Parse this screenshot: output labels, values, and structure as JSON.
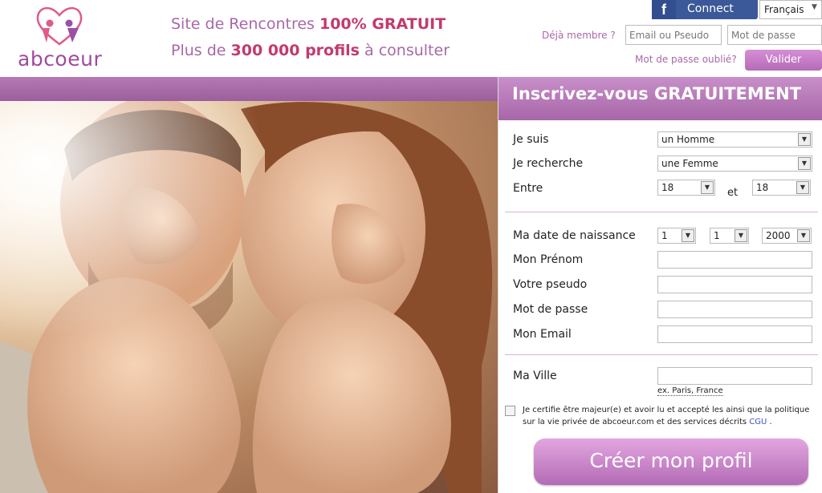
{
  "header": {
    "logo_text": "abcoeur",
    "tagline1_prefix": "Site de Rencontres ",
    "tagline1_bold": "100% GRATUIT",
    "tagline2_prefix": "Plus de ",
    "tagline2_bold": "300 000 profils",
    "tagline2_suffix": " à consulter",
    "facebook_label": "Connect",
    "language": "Français",
    "member_prompt": "Déjà membre ?",
    "email_placeholder": "Email ou Pseudo",
    "password_placeholder": "Mot de passe",
    "forgot_label": "Mot de passe oublié?",
    "submit_label": "Valider"
  },
  "form": {
    "title": "Inscrivez-vous GRATUITEMENT",
    "je_suis_label": "Je suis",
    "je_suis_value": "un Homme",
    "je_recherche_label": "Je recherche",
    "je_recherche_value": "une Femme",
    "entre_label": "Entre",
    "age_min": "18",
    "et_label": "et",
    "age_max": "18",
    "birth_label": "Ma date de naissance",
    "birth_day": "1",
    "birth_month": "1",
    "birth_year": "2000",
    "prenom_label": "Mon Prénom",
    "pseudo_label": "Votre pseudo",
    "password_label": "Mot de passe",
    "email_label": "Mon Email",
    "ville_label": "Ma Ville",
    "ville_hint": "ex. Paris, France",
    "cert_text": "Je certifie être majeur(e) et avoir lu et accepté les ainsi que la politique sur la vie privée de abcoeur.com et des services décrits ",
    "cgu_label": "CGU",
    "cert_end": " .",
    "create_label": "Créer mon profil"
  },
  "colors": {
    "brand_purple": "#a04a9f",
    "accent_pink": "#c33a6d",
    "facebook_blue": "#3b5998"
  }
}
